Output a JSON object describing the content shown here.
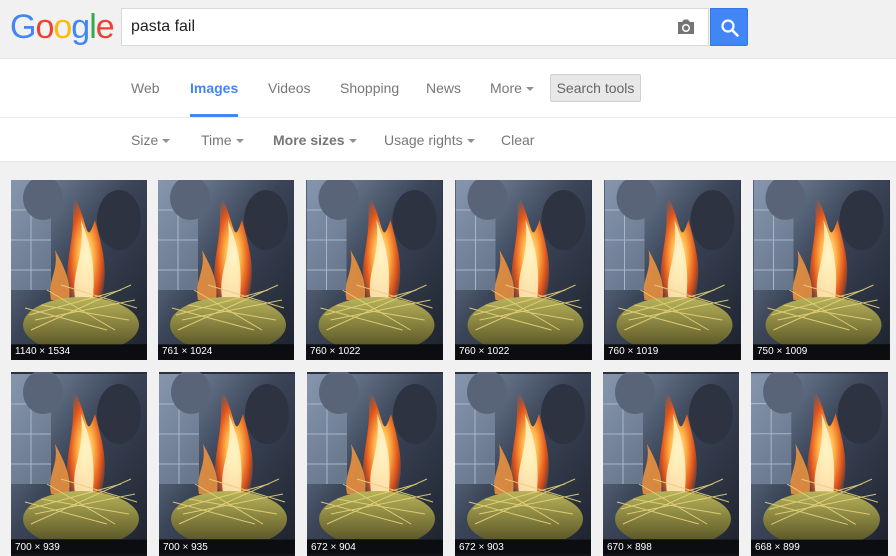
{
  "logo": {
    "letters": [
      "G",
      "o",
      "o",
      "g",
      "l",
      "e"
    ],
    "colors": [
      "#4285f4",
      "#ea4335",
      "#fbbc05",
      "#4285f4",
      "#34a853",
      "#ea4335"
    ]
  },
  "search": {
    "query": "pasta fail",
    "camera_icon": "camera-icon",
    "search_icon": "magnifier-icon"
  },
  "tabs": [
    {
      "label": "Web",
      "active": false
    },
    {
      "label": "Images",
      "active": true
    },
    {
      "label": "Videos",
      "active": false
    },
    {
      "label": "Shopping",
      "active": false
    },
    {
      "label": "News",
      "active": false
    },
    {
      "label": "More",
      "active": false,
      "dropdown": true
    }
  ],
  "search_tools_label": "Search tools",
  "tools": [
    {
      "label": "Size",
      "dropdown": true,
      "bold": false
    },
    {
      "label": "Time",
      "dropdown": true,
      "bold": false
    },
    {
      "label": "More sizes",
      "dropdown": true,
      "bold": true
    },
    {
      "label": "Usage rights",
      "dropdown": true,
      "bold": false
    },
    {
      "label": "Clear",
      "dropdown": false,
      "bold": false
    }
  ],
  "results": [
    {
      "dims": "1140 × 1534"
    },
    {
      "dims": "761 × 1024"
    },
    {
      "dims": "760 × 1022"
    },
    {
      "dims": "760 × 1022"
    },
    {
      "dims": "760 × 1019"
    },
    {
      "dims": "750 × 1009"
    },
    {
      "dims": "700 × 939"
    },
    {
      "dims": "700 × 935"
    },
    {
      "dims": "672 × 904"
    },
    {
      "dims": "672 × 903"
    },
    {
      "dims": "670 × 898"
    },
    {
      "dims": "668 × 899"
    }
  ],
  "colors": {
    "accent": "#4285f4",
    "tab_text": "#777777",
    "page_bg": "#f1f1f1"
  }
}
